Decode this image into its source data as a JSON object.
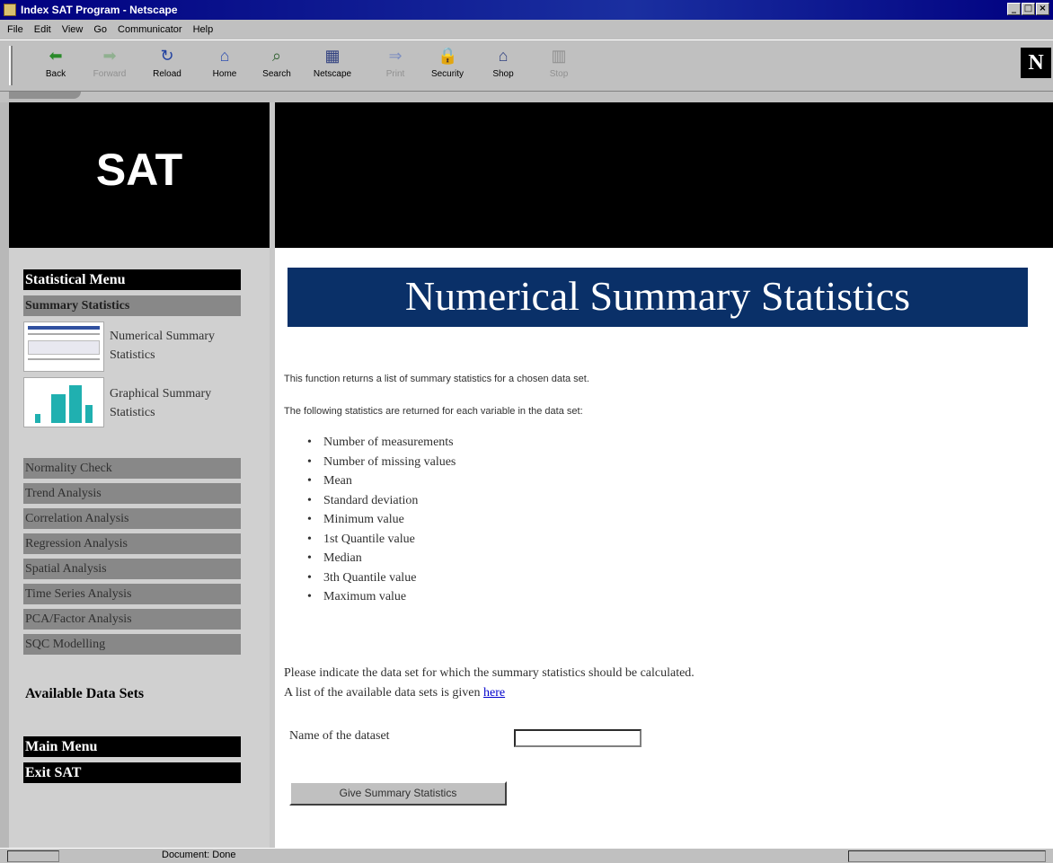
{
  "window": {
    "title": "Index SAT Program - Netscape",
    "buttons": [
      "_",
      "□",
      "×"
    ]
  },
  "menubar": [
    "File",
    "Edit",
    "View",
    "Go",
    "Communicator",
    "Help"
  ],
  "toolbar": {
    "buttons": [
      {
        "label": "Back",
        "icon": "back-arrow-icon",
        "glyph": "⬅",
        "disabled": false
      },
      {
        "label": "Forward",
        "icon": "forward-arrow-icon",
        "glyph": "➡",
        "disabled": true
      },
      {
        "label": "Reload",
        "icon": "reload-icon",
        "glyph": "↻",
        "disabled": false
      },
      {
        "label": "Home",
        "icon": "home-icon",
        "glyph": "⌂",
        "disabled": false
      },
      {
        "label": "Search",
        "icon": "search-icon",
        "glyph": "⌕",
        "disabled": false
      },
      {
        "label": "Netscape",
        "icon": "netscape-icon",
        "glyph": "▦",
        "disabled": false
      },
      {
        "label": "Print",
        "icon": "print-icon",
        "glyph": "⇒",
        "disabled": true
      },
      {
        "label": "Security",
        "icon": "security-lock-icon",
        "glyph": "🔒",
        "disabled": false
      },
      {
        "label": "Shop",
        "icon": "shop-bag-icon",
        "glyph": "⌂",
        "disabled": false
      },
      {
        "label": "Stop",
        "icon": "stop-icon",
        "glyph": "▥",
        "disabled": true
      }
    ],
    "logo": "N"
  },
  "left": {
    "header": "SAT",
    "statistical_menu": "Statistical Menu",
    "summary_statistics": "Summary Statistics",
    "thumb1_label": "Numerical Summary Statistics",
    "thumb2_label": "Graphical Summary Statistics",
    "menu_items": [
      "Normality Check",
      "Trend Analysis",
      "Correlation Analysis",
      "Regression Analysis",
      "Spatial Analysis",
      "Time Series Analysis",
      "PCA/Factor Analysis",
      "SQC Modelling"
    ],
    "available_data_sets": "Available Data Sets",
    "main_menu": "Main Menu",
    "exit": "Exit SAT"
  },
  "main": {
    "title": "Numerical Summary Statistics",
    "intro1": "This function returns a list of summary statistics for a chosen data set.",
    "intro2": "The following statistics are returned for each variable in the data set:",
    "stats": [
      "Number of measurements",
      "Number of missing values",
      "Mean",
      "Standard deviation",
      "Minimum value",
      "1st Quantile value",
      "Median",
      "3th Quantile value",
      "Maximum value"
    ],
    "instruction1": "Please indicate the data set for which the summary statistics should be calculated.",
    "instruction2": "A list of the available data sets is given",
    "here_link": "here",
    "field_label": "Name of the dataset",
    "field_value": "",
    "submit_label": "Give Summary Statistics"
  },
  "status": {
    "text": "Document: Done"
  }
}
